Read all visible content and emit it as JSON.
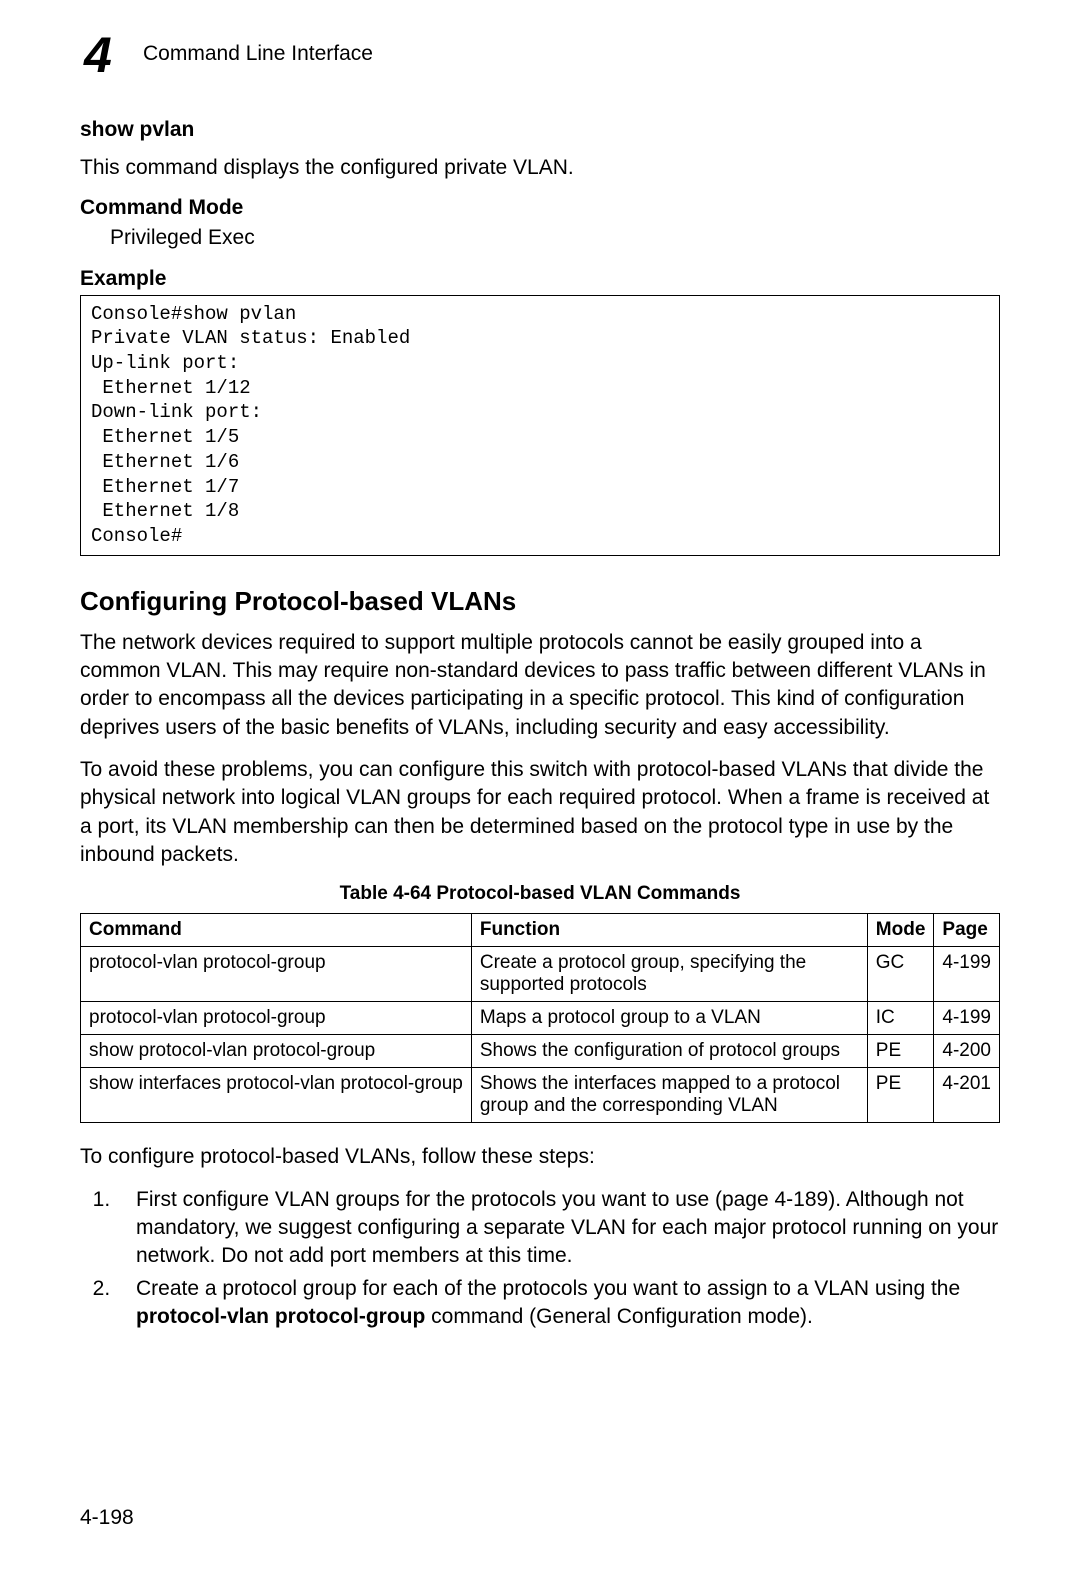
{
  "header": {
    "chapter_number": "4",
    "breadcrumb": "Command Line Interface"
  },
  "section1": {
    "title": "show pvlan",
    "description": "This command displays the configured private VLAN.",
    "command_mode_label": "Command Mode",
    "command_mode_value": "Privileged Exec",
    "example_label": "Example",
    "example_code": "Console#show pvlan\nPrivate VLAN status: Enabled\nUp-link port:\n Ethernet 1/12\nDown-link port:\n Ethernet 1/5\n Ethernet 1/6\n Ethernet 1/7\n Ethernet 1/8\nConsole#"
  },
  "section2": {
    "title": "Configuring Protocol-based VLANs",
    "para1": "The network devices required to support multiple protocols cannot be easily grouped into a common VLAN. This may require non-standard devices to pass traffic between different VLANs in order to encompass all the devices participating in a specific protocol. This kind of configuration deprives users of the basic benefits of VLANs, including security and easy accessibility.",
    "para2": "To avoid these problems, you can configure this switch with protocol-based VLANs that divide the physical network into logical VLAN groups for each required protocol. When a frame is received at a port, its VLAN membership can then be determined based on the protocol type in use by the inbound packets."
  },
  "table": {
    "caption": "Table 4-64   Protocol-based VLAN Commands",
    "headers": {
      "command": "Command",
      "function": "Function",
      "mode": "Mode",
      "page": "Page"
    },
    "rows": [
      {
        "command": "protocol-vlan protocol-group",
        "function": "Create a protocol group, specifying the supported protocols",
        "mode": "GC",
        "page": "4-199"
      },
      {
        "command": "protocol-vlan protocol-group",
        "function": "Maps a protocol group to a VLAN",
        "mode": "IC",
        "page": "4-199"
      },
      {
        "command": "show protocol-vlan protocol-group",
        "function": "Shows the configuration of protocol groups",
        "mode": "PE",
        "page": "4-200"
      },
      {
        "command": "show interfaces protocol-vlan protocol-group",
        "function": "Shows the interfaces mapped to a protocol group and the corresponding VLAN",
        "mode": "PE",
        "page": "4-201"
      }
    ]
  },
  "steps": {
    "intro": "To configure protocol-based VLANs, follow these steps:",
    "items": [
      {
        "pre": "First configure VLAN groups for the protocols you want to use (page 4-189). Although not mandatory, we suggest configuring a separate VLAN for each major protocol running on your network. Do not add port members at this time."
      },
      {
        "pre": "Create a protocol group for each of the protocols you want to assign to a VLAN using the ",
        "bold": "protocol-vlan protocol-group",
        "post": " command (General Configuration mode)."
      }
    ]
  },
  "page_number": "4-198"
}
